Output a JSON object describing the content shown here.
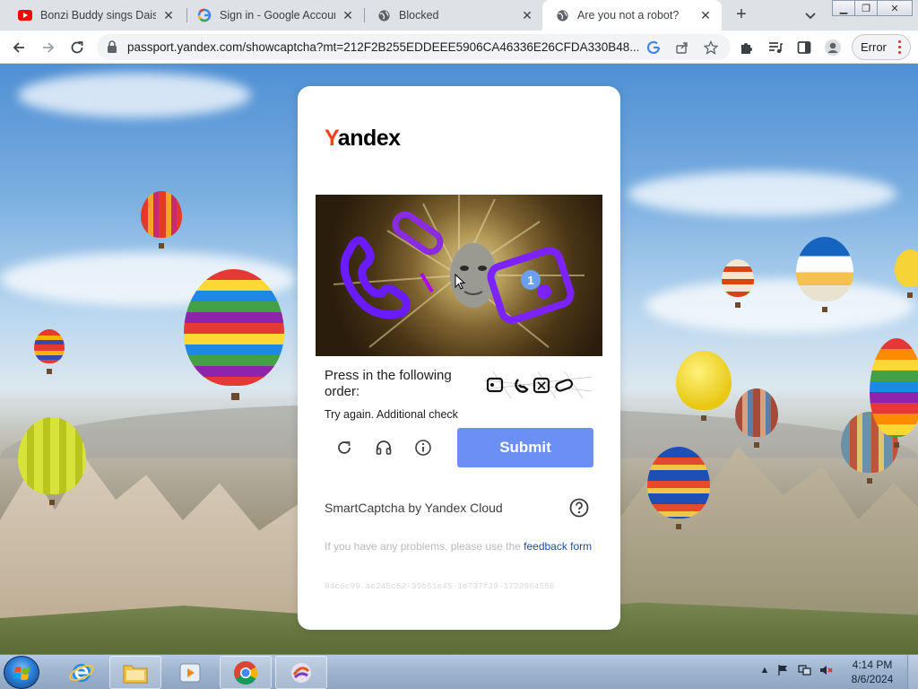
{
  "browser": {
    "tabs": [
      {
        "title": "Bonzi Buddy sings Daisy",
        "favicon": "youtube-icon"
      },
      {
        "title": "Sign in - Google Accounts",
        "favicon": "google-icon"
      },
      {
        "title": "Blocked",
        "favicon": "globe-icon"
      },
      {
        "title": "Are you not a robot?",
        "favicon": "globe-icon",
        "active": true
      }
    ],
    "url": "passport.yandex.com/showcaptcha?mt=212F2B255EDDEEE5906CA46336E26CFDA330B48...",
    "profile_error_label": "Error"
  },
  "captcha": {
    "logo_initial": "Y",
    "logo_rest": "andex",
    "marker_number": "1",
    "instruction": "Press in the following order:",
    "retry_message": "Try again. Additional check",
    "submit_label": "Submit",
    "provider": "SmartCaptcha by Yandex Cloud",
    "problems_text": "If you have any problems, please use the ",
    "feedback_link": "feedback form",
    "request_id": "84c6c99.ae245c52-39b51e45-1e737f39-1722964556"
  },
  "taskbar": {
    "time": "4:14 PM",
    "date": "8/6/2024"
  },
  "colors": {
    "accent": "#6c8ff5",
    "yandex_red": "#fc3f1d",
    "link": "#1c4a9c"
  }
}
